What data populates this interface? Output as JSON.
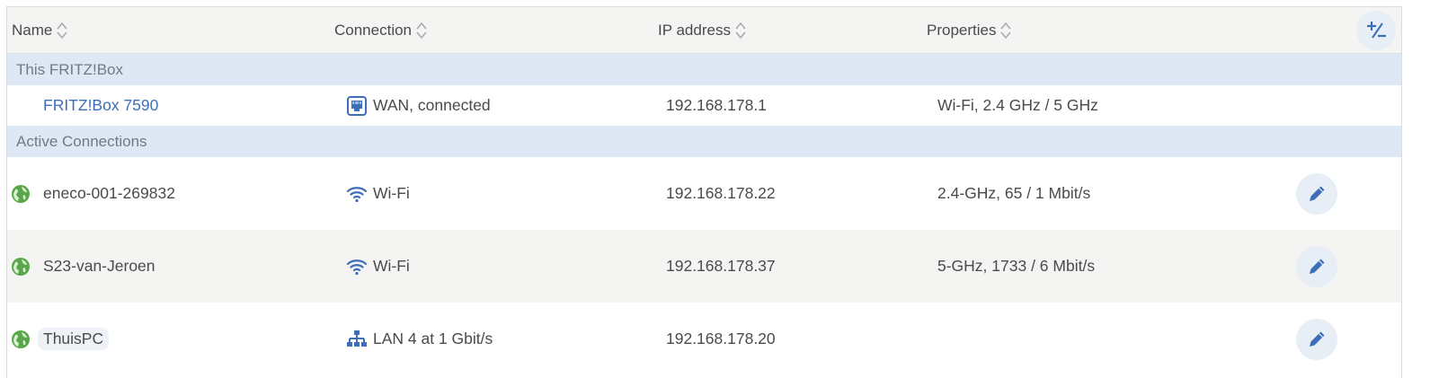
{
  "columns": {
    "name": "Name",
    "connection": "Connection",
    "ip": "IP address",
    "properties": "Properties"
  },
  "sections": {
    "this_box": "This FRITZ!Box",
    "active": "Active Connections"
  },
  "fritzbox": {
    "name": "FRITZ!Box 7590",
    "connection": "WAN, connected",
    "ip": "192.168.178.1",
    "properties": "Wi-Fi, 2.4 GHz / 5 GHz"
  },
  "devices": [
    {
      "name": "eneco-001-269832",
      "connection_icon": "wifi-icon",
      "connection": "Wi-Fi",
      "ip": "192.168.178.22",
      "properties": "2.4-GHz, 65 / 1 Mbit/s"
    },
    {
      "name": "S23-van-Jeroen",
      "connection_icon": "wifi-icon",
      "connection": "Wi-Fi",
      "ip": "192.168.178.37",
      "properties": "5-GHz, 1733 / 6 Mbit/s"
    },
    {
      "name": "ThuisPC",
      "connection_icon": "lan-icon",
      "connection": "LAN 4 at 1 Gbit/s",
      "ip": "192.168.178.20",
      "properties": ""
    }
  ],
  "colors": {
    "accent": "#3d6fb8",
    "section_bg": "#dde8f4",
    "online_globe": "#5aa64a"
  }
}
